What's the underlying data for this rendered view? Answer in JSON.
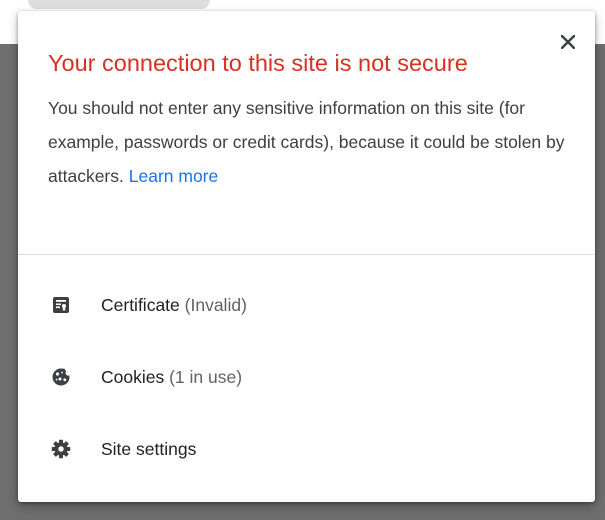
{
  "colors": {
    "warning_red": "#d93025",
    "link_blue": "#1a73e8",
    "icon_gray": "#3c4043"
  },
  "popup": {
    "close_icon": "close-icon",
    "title": "Your connection to this site is not secure",
    "description": "You should not enter any sensitive information on this site (for example, passwords or credit cards), because it could be stolen by attackers.",
    "learn_more": "Learn more"
  },
  "items": [
    {
      "icon": "certificate-icon",
      "label": "Certificate",
      "detail": "(Invalid)"
    },
    {
      "icon": "cookie-icon",
      "label": "Cookies",
      "detail": "(1 in use)"
    },
    {
      "icon": "gear-icon",
      "label": "Site settings",
      "detail": ""
    }
  ]
}
